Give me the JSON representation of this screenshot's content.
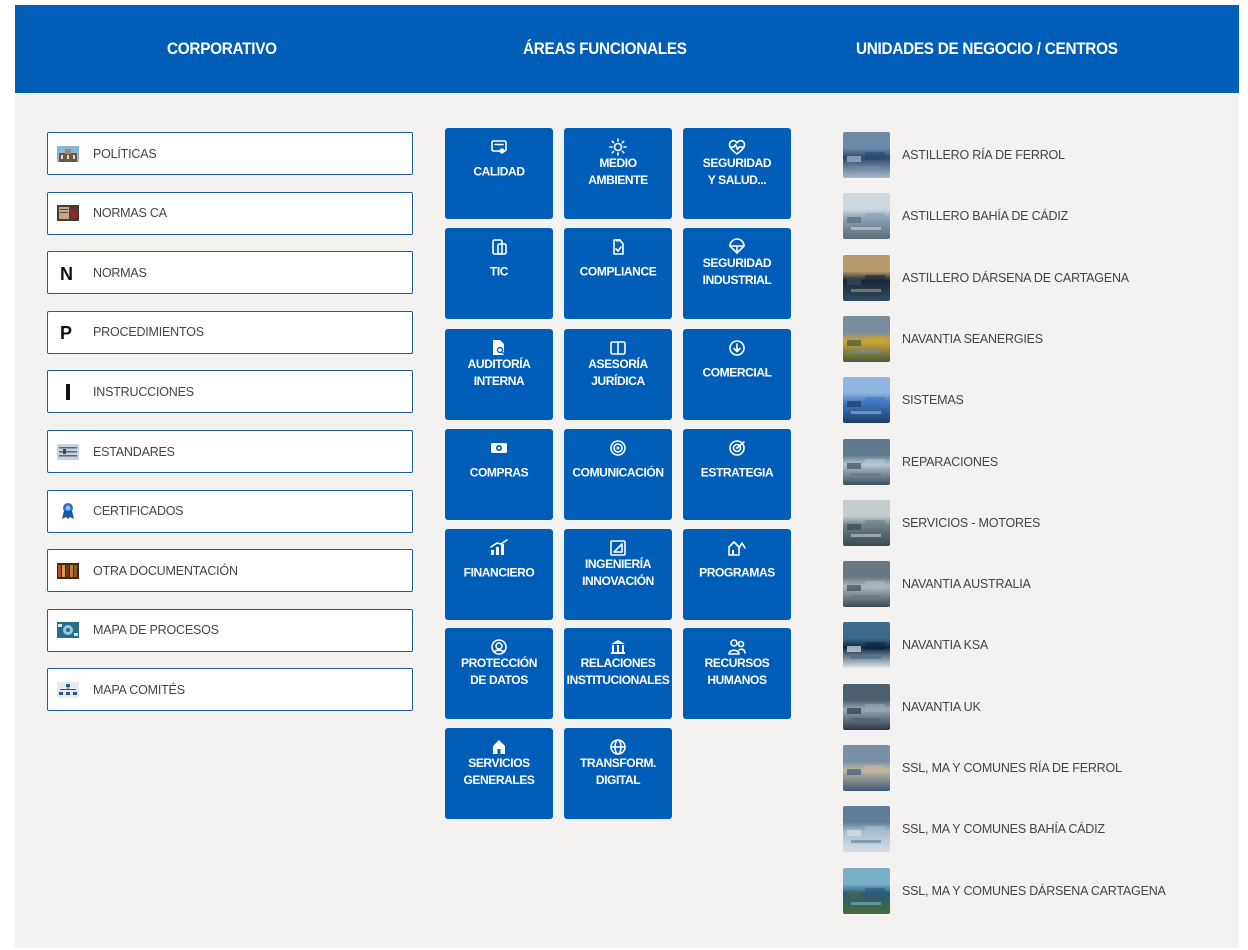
{
  "header": {
    "corporativo": "CORPORATIVO",
    "areas": "ÁREAS FUNCIONALES",
    "unidades": "UNIDADES DE NEGOCIO / CENTROS"
  },
  "corporativo": [
    {
      "label": "POLÍTICAS",
      "icon": "building-photo-icon"
    },
    {
      "label": "NORMAS CA",
      "icon": "document-photo-icon"
    },
    {
      "label": "NORMAS",
      "icon": "letter-n-icon"
    },
    {
      "label": "PROCEDIMIENTOS",
      "icon": "letter-p-icon"
    },
    {
      "label": "INSTRUCCIONES",
      "icon": "letter-i-icon"
    },
    {
      "label": "ESTANDARES",
      "icon": "standards-icon"
    },
    {
      "label": "CERTIFICADOS",
      "icon": "certificate-ribbon-icon"
    },
    {
      "label": "OTRA DOCUMENTACIÓN",
      "icon": "books-icon"
    },
    {
      "label": "MAPA DE PROCESOS",
      "icon": "process-map-icon"
    },
    {
      "label": "MAPA COMITÉS",
      "icon": "committee-map-icon"
    }
  ],
  "areas": [
    {
      "label": "CALIDAD",
      "icon": "quality-certificate-icon"
    },
    {
      "label": "MEDIO\nAMBIENTE",
      "icon": "sun-icon"
    },
    {
      "label": "SEGURIDAD\nY SALUD...",
      "icon": "heart-pulse-icon"
    },
    {
      "label": "TIC",
      "icon": "devices-icon"
    },
    {
      "label": "COMPLIANCE",
      "icon": "compliance-icon"
    },
    {
      "label": "SEGURIDAD\nINDUSTRIAL",
      "icon": "parachute-icon"
    },
    {
      "label": "AUDITORÍA\nINTERNA",
      "icon": "document-search-icon"
    },
    {
      "label": "ASESORÍA\nJURÍDICA",
      "icon": "book-open-icon"
    },
    {
      "label": "COMERCIAL",
      "icon": "download-circle-icon"
    },
    {
      "label": "COMPRAS",
      "icon": "money-icon"
    },
    {
      "label": "COMUNICACIÓN",
      "icon": "broadcast-icon"
    },
    {
      "label": "ESTRATEGIA",
      "icon": "target-icon"
    },
    {
      "label": "FINANCIERO",
      "icon": "chart-growth-icon"
    },
    {
      "label": "INGENIERÍA\nINNOVACIÓN",
      "icon": "ruler-design-icon"
    },
    {
      "label": "PROGRAMAS",
      "icon": "house-chart-icon"
    },
    {
      "label": "PROTECCIÓN\nDE DATOS",
      "icon": "data-protection-icon"
    },
    {
      "label": "RELACIONES\nINSTITUCIONALES",
      "icon": "institution-icon"
    },
    {
      "label": "RECURSOS\nHUMANOS",
      "icon": "people-icon"
    },
    {
      "label": "SERVICIOS\nGENERALES",
      "icon": "home-icon"
    },
    {
      "label": "TRANSFORM.\nDIGITAL",
      "icon": "globe-icon"
    }
  ],
  "unidades": [
    {
      "label": "ASTILLERO RÍA DE FERROL",
      "thumb": [
        "#2c4a6e",
        "#6c8aa8",
        "#a9b8c6"
      ]
    },
    {
      "label": "ASTILLERO BAHÍA DE CÁDIZ",
      "thumb": [
        "#8aa2b8",
        "#cfd8e0",
        "#5d6b76"
      ]
    },
    {
      "label": "ASTILLERO DÁRSENA DE CARTAGENA",
      "thumb": [
        "#1a2a3a",
        "#b89b6c",
        "#2e4b63"
      ]
    },
    {
      "label": "NAVANTIA SEANERGIES",
      "thumb": [
        "#c9a53a",
        "#7a8c9c",
        "#4a5a3a"
      ]
    },
    {
      "label": "SISTEMAS",
      "thumb": [
        "#3f78c0",
        "#8fb5e0",
        "#1d3f6a"
      ]
    },
    {
      "label": "REPARACIONES",
      "thumb": [
        "#b7c5cf",
        "#5e7a8c",
        "#3a5060"
      ]
    },
    {
      "label": "SERVICIOS - MOTORES",
      "thumb": [
        "#6f7f88",
        "#c4ccd0",
        "#3a4a52"
      ]
    },
    {
      "label": "NAVANTIA AUSTRALIA",
      "thumb": [
        "#aeb8c0",
        "#6b7780",
        "#3e4a54"
      ]
    },
    {
      "label": "NAVANTIA KSA",
      "thumb": [
        "#0f2740",
        "#3d6a8c",
        "#dfe6ec"
      ]
    },
    {
      "label": "NAVANTIA UK",
      "thumb": [
        "#9aa8b4",
        "#4d5e6c",
        "#2a3a48"
      ]
    },
    {
      "label": "SSL, MA Y COMUNES RÍA DE FERROL",
      "thumb": [
        "#c3b8a0",
        "#7a8fa4",
        "#3e5a78"
      ]
    },
    {
      "label": "SSL, MA Y COMUNES BAHÍA CÁDIZ",
      "thumb": [
        "#a8bccd",
        "#5f7d98",
        "#d8e0e6"
      ]
    },
    {
      "label": "SSL, MA Y COMUNES DÁRSENA CARTAGENA",
      "thumb": [
        "#2a5a7a",
        "#7ab0c8",
        "#4a6a3a"
      ]
    }
  ]
}
